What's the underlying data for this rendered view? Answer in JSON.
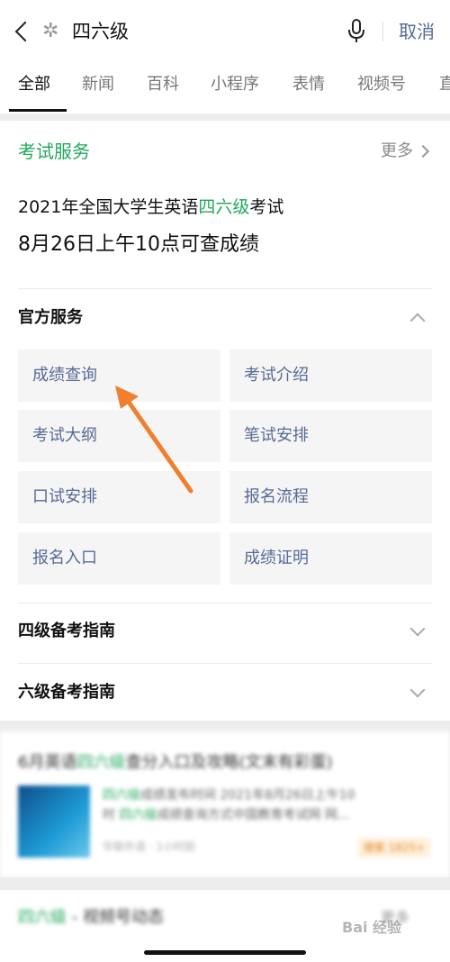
{
  "header": {
    "query": "四六级",
    "cancel_label": "取消"
  },
  "tabs": [
    {
      "label": "全部",
      "active": true
    },
    {
      "label": "新闻"
    },
    {
      "label": "百科"
    },
    {
      "label": "小程序"
    },
    {
      "label": "表情"
    },
    {
      "label": "视频号"
    },
    {
      "label": "直"
    }
  ],
  "exam_card": {
    "title": "考试服务",
    "more_label": "更多",
    "headline_prefix": "2021年全国大学生英语",
    "headline_highlight": "四六级",
    "headline_suffix": "考试",
    "headline2": "8月26日上午10点可查成绩",
    "official_title": "官方服务",
    "services": [
      "成绩查询",
      "考试介绍",
      "考试大纲",
      "笔试安排",
      "口试安排",
      "报名流程",
      "报名入口",
      "成绩证明"
    ],
    "guide_cet4": "四级备考指南",
    "guide_cet6": "六级备考指南"
  },
  "article": {
    "title_prefix": "6月英语",
    "title_highlight": "四六级",
    "title_suffix": "查分入口及攻略(文末有彩蛋)",
    "desc_line1_hl": "四六级",
    "desc_line1": "成绩发布时间 2021年8月26日上午10",
    "desc_line2_prefix": "时 ",
    "desc_line2_hl": "四六级",
    "desc_line2": "成绩查询方式中国教育考试网 网...",
    "meta": "华联外语 · 1小时前",
    "badge": "搜索 1825+"
  },
  "video": {
    "title_hl": "四六级",
    "title": " - 视频号动态",
    "more_label": "更多"
  },
  "watermark": "Bai 经验",
  "colors": {
    "accent_green": "#21a85a",
    "link_blue": "#576b95",
    "arrow_orange": "#f07f2e"
  }
}
